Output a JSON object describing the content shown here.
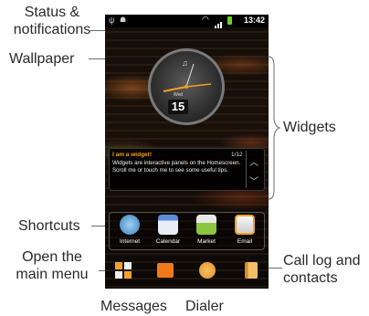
{
  "callouts": {
    "status": "Status &\nnotifications",
    "wallpaper": "Wallpaper",
    "widgets": "Widgets",
    "shortcuts": "Shortcuts",
    "open_menu": "Open the\nmain menu",
    "messages": "Messages",
    "dialer": "Dialer",
    "call_log": "Call log and\ncontacts"
  },
  "status_bar": {
    "time": "13:42"
  },
  "clock": {
    "day": "Wed",
    "date": "15"
  },
  "widget_tip": {
    "title": "I am a widget!",
    "counter": "1/12",
    "body": "Widgets are interactive panels on the Homescreen. Scroll me or touch me to see some useful tips."
  },
  "shortcuts": [
    {
      "label": "Internet",
      "icon": "internet-icon"
    },
    {
      "label": "Calendar",
      "icon": "calendar-icon"
    },
    {
      "label": "Market",
      "icon": "market-icon"
    },
    {
      "label": "Email",
      "icon": "email-icon"
    }
  ],
  "dock": [
    {
      "icon": "main-menu-icon",
      "color": "#f2a12b"
    },
    {
      "icon": "messages-icon",
      "color": "#f07a1a"
    },
    {
      "icon": "dialer-icon",
      "color": "#e8922a"
    },
    {
      "icon": "contacts-icon",
      "color": "#e8a23a"
    }
  ]
}
